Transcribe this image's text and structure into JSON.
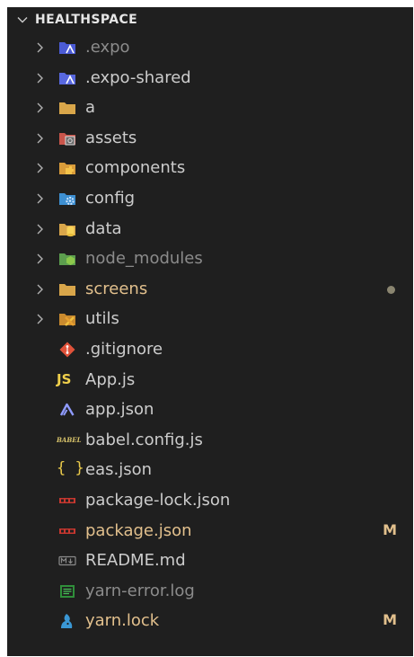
{
  "explorer": {
    "title": "HEALTHSPACE",
    "items": [
      {
        "label": ".expo",
        "kind": "folder",
        "icon": "expo-folder-icon",
        "state": "dim"
      },
      {
        "label": ".expo-shared",
        "kind": "folder",
        "icon": "expo-folder-icon",
        "state": "normal"
      },
      {
        "label": "a",
        "kind": "folder",
        "icon": "folder-icon",
        "state": "normal"
      },
      {
        "label": "assets",
        "kind": "folder",
        "icon": "assets-folder-icon",
        "state": "normal"
      },
      {
        "label": "components",
        "kind": "folder",
        "icon": "components-folder-icon",
        "state": "normal"
      },
      {
        "label": "config",
        "kind": "folder",
        "icon": "config-folder-icon",
        "state": "normal"
      },
      {
        "label": "data",
        "kind": "folder",
        "icon": "data-folder-icon",
        "state": "normal"
      },
      {
        "label": "node_modules",
        "kind": "folder",
        "icon": "node-modules-folder-icon",
        "state": "dim"
      },
      {
        "label": "screens",
        "kind": "folder",
        "icon": "folder-icon",
        "state": "modified",
        "decoration": "dot"
      },
      {
        "label": "utils",
        "kind": "folder",
        "icon": "utils-folder-icon",
        "state": "normal"
      },
      {
        "label": ".gitignore",
        "kind": "file",
        "icon": "git-icon",
        "state": "normal"
      },
      {
        "label": "App.js",
        "kind": "file",
        "icon": "javascript-icon",
        "icon_text": "JS",
        "state": "normal"
      },
      {
        "label": "app.json",
        "kind": "file",
        "icon": "expo-icon",
        "state": "normal"
      },
      {
        "label": "babel.config.js",
        "kind": "file",
        "icon": "babel-icon",
        "icon_text": "BABEL",
        "state": "normal"
      },
      {
        "label": "eas.json",
        "kind": "file",
        "icon": "json-icon",
        "icon_text": "{ }",
        "state": "normal"
      },
      {
        "label": "package-lock.json",
        "kind": "file",
        "icon": "npm-icon",
        "state": "normal"
      },
      {
        "label": "package.json",
        "kind": "file",
        "icon": "npm-icon",
        "state": "modified",
        "badge": "M"
      },
      {
        "label": "README.md",
        "kind": "file",
        "icon": "markdown-icon",
        "state": "normal"
      },
      {
        "label": "yarn-error.log",
        "kind": "file",
        "icon": "log-icon",
        "state": "dim"
      },
      {
        "label": "yarn.lock",
        "kind": "file",
        "icon": "yarn-icon",
        "state": "modified",
        "badge": "M"
      }
    ]
  },
  "colors": {
    "background": "#1f1f1f",
    "text": "#cccccc",
    "dim_text": "#8b8b8b",
    "modified": "#e2c08d"
  }
}
